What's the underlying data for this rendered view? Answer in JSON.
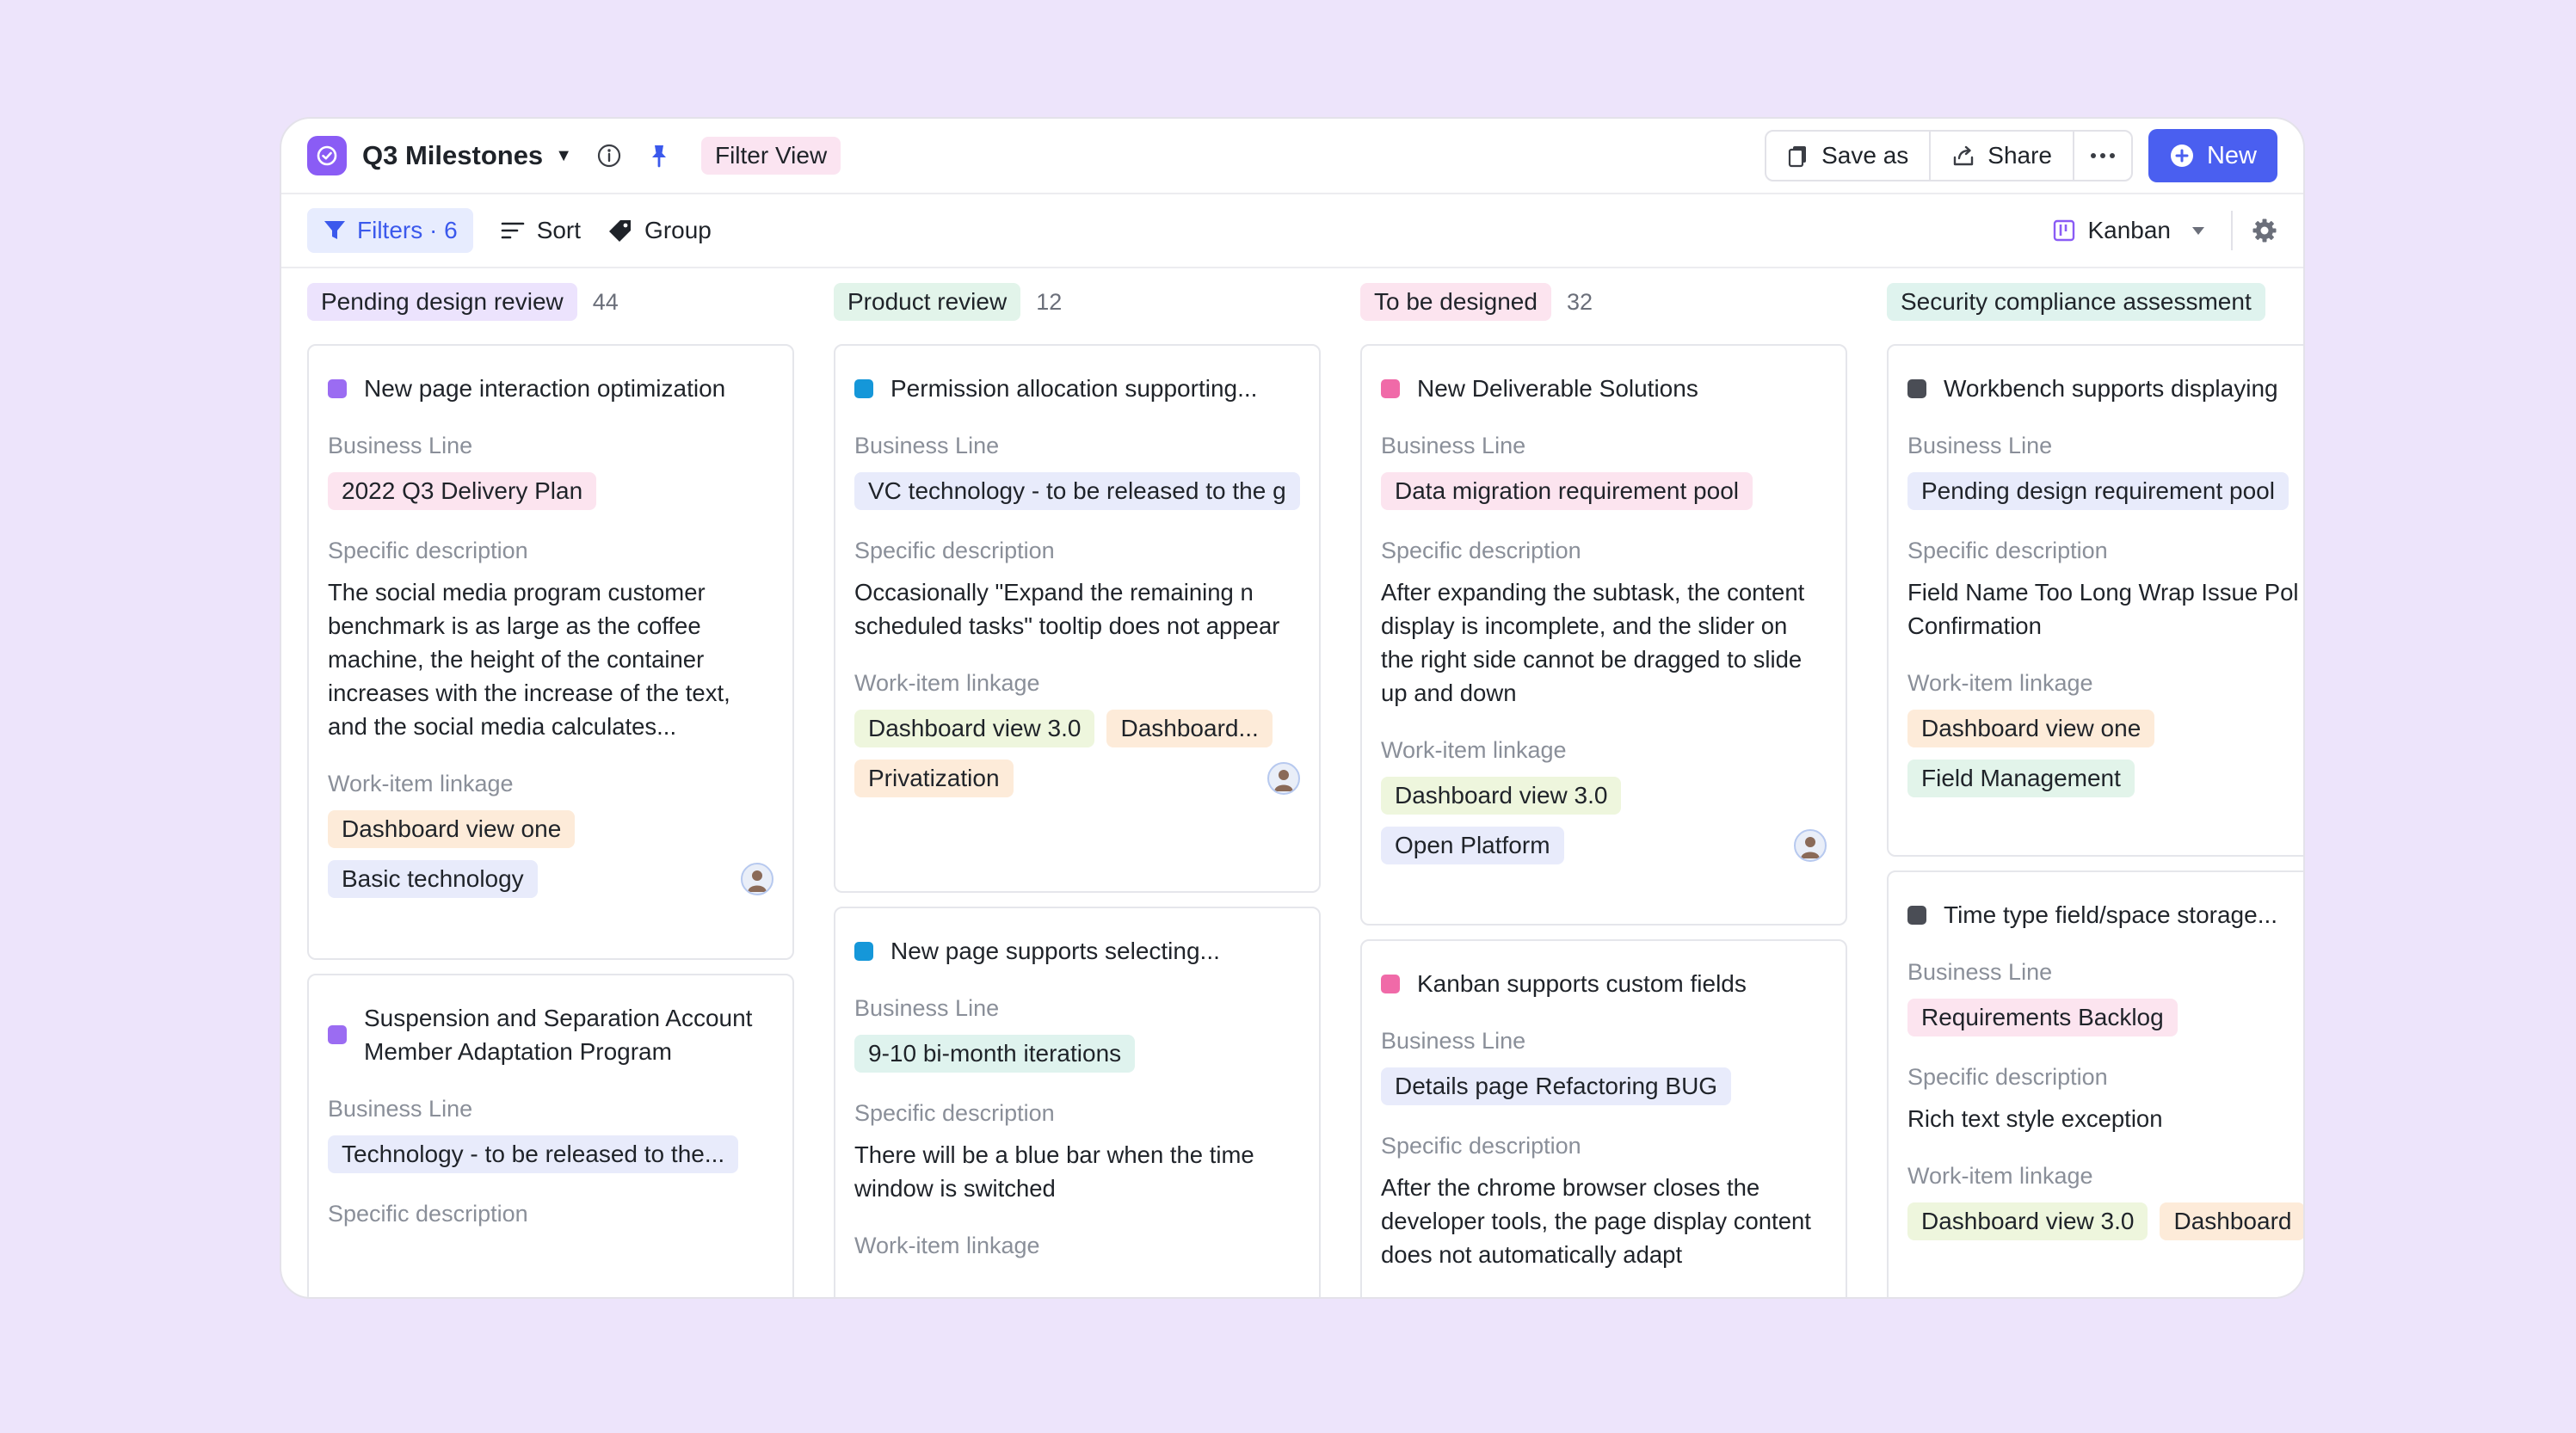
{
  "header": {
    "title": "Q3 Milestones",
    "filter_view": "Filter View",
    "save_as": "Save as",
    "share": "Share",
    "new": "New"
  },
  "toolbar": {
    "filters": "Filters · 6",
    "sort": "Sort",
    "group": "Group",
    "view": "Kanban"
  },
  "labels": {
    "business_line": "Business Line",
    "specific_description": "Specific description",
    "work_item_linkage": "Work-item linkage"
  },
  "columns": [
    {
      "name": "Pending design review",
      "count": "44",
      "color": "#ece3fd",
      "cards": [
        {
          "title": "New page interaction optimization",
          "dot_color": "#9b6cf2",
          "business_line": "2022 Q3 Delivery Plan",
          "description": "The social media program customer benchmark is as large as the coffee machine, the height of the container increases with the increase of the text, and the social media calculates...",
          "linkage": [
            "Dashboard view one"
          ],
          "extra": "Basic technology"
        },
        {
          "title": "Suspension and Separation Account Member Adaptation Program",
          "dot_color": "#9b6cf2",
          "business_line": "Technology - to be released to the..."
        }
      ]
    },
    {
      "name": "Product review",
      "count": "12",
      "color": "#e2f4ea",
      "cards": [
        {
          "title": "Permission allocation supporting...",
          "dot_color": "#1597d9",
          "business_line": "VC technology - to be released to the g",
          "description": "Occasionally \"Expand the remaining n scheduled tasks\" tooltip does not appear",
          "linkage": [
            "Dashboard view 3.0",
            "Dashboard..."
          ],
          "extra": "Privatization"
        },
        {
          "title": "New page supports selecting...",
          "dot_color": "#1597d9",
          "business_line": "9-10 bi-month iterations",
          "description": "There will be a blue bar when the time window is switched"
        }
      ]
    },
    {
      "name": "To be designed",
      "count": "32",
      "color": "#fce4ef",
      "cards": [
        {
          "title": "New Deliverable Solutions",
          "dot_color": "#f06aa8",
          "business_line": "Data migration requirement pool",
          "description": "After expanding the subtask, the content display is incomplete, and the slider on the right side cannot be dragged to slide up and down",
          "linkage": [
            "Dashboard view 3.0"
          ],
          "extra": "Open Platform"
        },
        {
          "title": "Kanban supports custom fields",
          "dot_color": "#f06aa8",
          "business_line": "Details page Refactoring BUG",
          "description": "After the chrome browser closes the developer tools, the page display content does not automatically adapt"
        }
      ]
    },
    {
      "name": "Security compliance assessment",
      "count": "",
      "color": "#dff3ee",
      "cards": [
        {
          "title": "Workbench supports displaying",
          "dot_color": "#4a4d55",
          "business_line": "Pending design requirement pool",
          "description": "Field Name Too Long Wrap Issue Pol Confirmation",
          "linkage": [
            "Dashboard view one"
          ],
          "extra": "Field Management"
        },
        {
          "title": "Time type field/space storage...",
          "dot_color": "#4a4d55",
          "business_line": "Requirements Backlog",
          "description": "Rich text style exception",
          "linkage": [
            "Dashboard view 3.0",
            "Dashboard"
          ]
        }
      ]
    }
  ]
}
